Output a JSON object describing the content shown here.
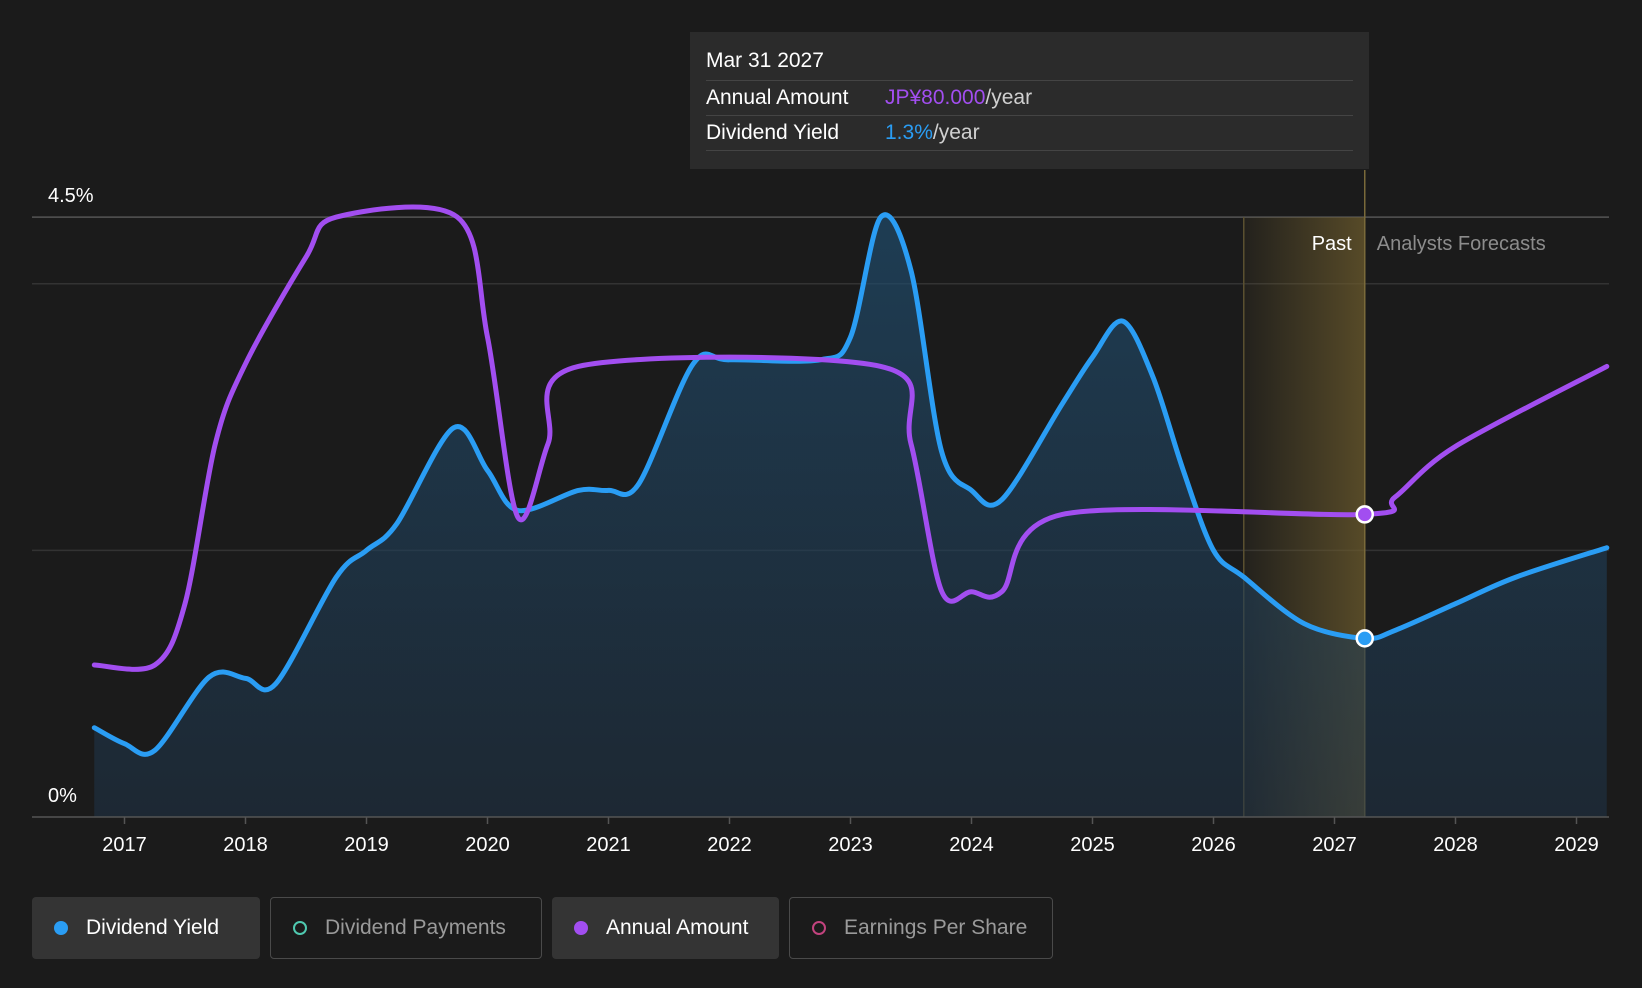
{
  "tooltip": {
    "date": "Mar 31 2027",
    "rows": [
      {
        "label": "Annual Amount",
        "value": "JP¥80.000",
        "unit": "/year"
      },
      {
        "label": "Dividend Yield",
        "value": "1.3%",
        "unit": "/year"
      }
    ]
  },
  "colors": {
    "dividend_yield": "#2a9df4",
    "annual_amount": "#a24ef0",
    "dividend_payments": "#4fc9b0",
    "earnings_per_share": "#c2437e",
    "forecast_band": "#6b5a2c",
    "background": "#1b1b1b"
  },
  "legend": {
    "items": [
      {
        "label": "Dividend Yield",
        "color": "#2a9df4",
        "active": true,
        "filled": true
      },
      {
        "label": "Dividend Payments",
        "color": "#4fc9b0",
        "active": false,
        "filled": false
      },
      {
        "label": "Annual Amount",
        "color": "#a24ef0",
        "active": true,
        "filled": true
      },
      {
        "label": "Earnings Per Share",
        "color": "#c2437e",
        "active": false,
        "filled": false
      }
    ]
  },
  "chart_data": {
    "type": "line",
    "ylim": [
      0,
      4.5
    ],
    "y_tick_labels": [
      {
        "value": 4.5,
        "label": "4.5%"
      },
      {
        "value": 0,
        "label": "0%"
      }
    ],
    "gridlines": [
      4.5,
      4.0,
      2.0
    ],
    "xlim": [
      2016.5,
      2029.25
    ],
    "x_ticks": [
      2017,
      2018,
      2019,
      2020,
      2021,
      2022,
      2023,
      2024,
      2025,
      2026,
      2027,
      2028,
      2029
    ],
    "past_label": "Past",
    "forecast_label": "Analysts Forecasts",
    "forecast_band": [
      2026.25,
      2027.25
    ],
    "highlight_x": 2027.25,
    "series": [
      {
        "name": "Dividend Yield",
        "key": "dividend_yield",
        "area": true,
        "points": [
          [
            2016.75,
            0.67
          ],
          [
            2017.0,
            0.55
          ],
          [
            2017.25,
            0.5
          ],
          [
            2017.7,
            1.05
          ],
          [
            2018.0,
            1.04
          ],
          [
            2018.25,
            1.0
          ],
          [
            2018.75,
            1.8
          ],
          [
            2019.0,
            2.0
          ],
          [
            2019.25,
            2.2
          ],
          [
            2019.72,
            2.92
          ],
          [
            2020.0,
            2.6
          ],
          [
            2020.25,
            2.3
          ],
          [
            2020.75,
            2.45
          ],
          [
            2021.0,
            2.45
          ],
          [
            2021.25,
            2.5
          ],
          [
            2021.7,
            3.4
          ],
          [
            2022.0,
            3.43
          ],
          [
            2022.75,
            3.43
          ],
          [
            2023.0,
            3.6
          ],
          [
            2023.25,
            4.5
          ],
          [
            2023.5,
            4.1
          ],
          [
            2023.75,
            2.75
          ],
          [
            2024.0,
            2.45
          ],
          [
            2024.25,
            2.38
          ],
          [
            2024.75,
            3.1
          ],
          [
            2025.0,
            3.45
          ],
          [
            2025.25,
            3.72
          ],
          [
            2025.5,
            3.3
          ],
          [
            2025.75,
            2.6
          ],
          [
            2026.0,
            2.0
          ],
          [
            2026.25,
            1.8
          ],
          [
            2026.75,
            1.45
          ],
          [
            2027.25,
            1.34
          ],
          [
            2027.5,
            1.4
          ],
          [
            2028.0,
            1.6
          ],
          [
            2028.5,
            1.8
          ],
          [
            2029.25,
            2.02
          ]
        ]
      },
      {
        "name": "Annual Amount",
        "key": "annual_amount",
        "area": false,
        "points": [
          [
            2016.75,
            1.14
          ],
          [
            2017.25,
            1.14
          ],
          [
            2017.5,
            1.6
          ],
          [
            2017.75,
            2.8
          ],
          [
            2018.0,
            3.4
          ],
          [
            2018.5,
            4.2
          ],
          [
            2018.75,
            4.5
          ],
          [
            2019.75,
            4.5
          ],
          [
            2020.0,
            3.6
          ],
          [
            2020.25,
            2.25
          ],
          [
            2020.5,
            2.8
          ],
          [
            2020.75,
            3.38
          ],
          [
            2023.25,
            3.38
          ],
          [
            2023.5,
            2.8
          ],
          [
            2023.75,
            1.7
          ],
          [
            2024.0,
            1.69
          ],
          [
            2024.25,
            1.69
          ],
          [
            2024.75,
            2.27
          ],
          [
            2027.25,
            2.27
          ],
          [
            2027.5,
            2.4
          ],
          [
            2028.0,
            2.78
          ],
          [
            2029.25,
            3.38
          ]
        ]
      }
    ]
  }
}
